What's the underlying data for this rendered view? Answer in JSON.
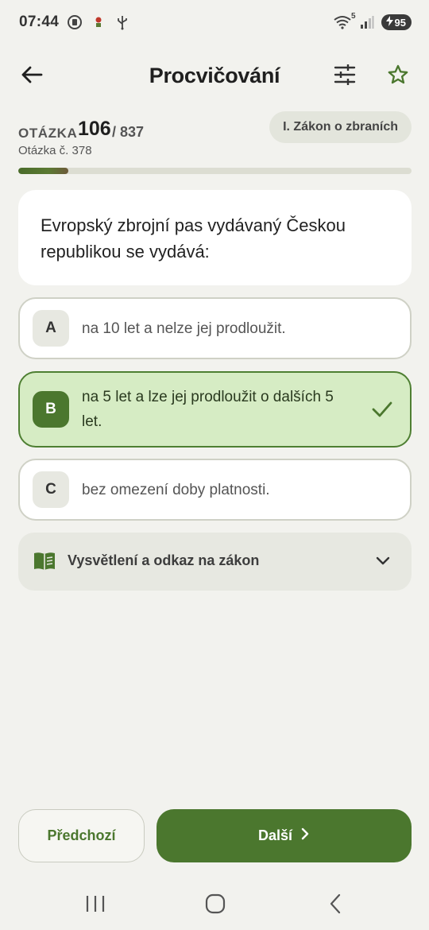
{
  "status_bar": {
    "time": "07:44",
    "wifi_label": "5",
    "battery": "95",
    "icons": [
      "record-icon",
      "notification-icon",
      "usb-icon",
      "wifi-icon",
      "signal-icon",
      "battery-charging-icon"
    ]
  },
  "app_bar": {
    "title": "Procvičování",
    "icons": [
      "back-arrow-icon",
      "filter-sliders-icon",
      "star-outline-icon"
    ]
  },
  "question_header": {
    "label": "OTÁZKA",
    "current": "106",
    "total": "/ 837",
    "subtitle": "Otázka č. 378",
    "chapter": "I. Zákon o zbraních",
    "progress": 0.127
  },
  "question": {
    "text": "Evropský zbrojní pas vydávaný Českou republikou se vydává:"
  },
  "answers": [
    {
      "letter": "A",
      "text": "na 10 let a nelze jej prodloužit.",
      "state": "normal"
    },
    {
      "letter": "B",
      "text": "na 5 let a lze jej prodloužit o dalších 5 let.",
      "state": "correct"
    },
    {
      "letter": "C",
      "text": "bez omezení doby platnosti.",
      "state": "normal"
    }
  ],
  "explanation": {
    "label": "Vysvětlení a odkaz na zákon",
    "icons": [
      "book-icon",
      "chevron-down-icon"
    ]
  },
  "buttons": {
    "prev": "Předchozí",
    "next": "Další"
  },
  "colors": {
    "accent": "#4b772e",
    "correct_bg": "#d6ecc4",
    "background": "#f2f2ee"
  }
}
